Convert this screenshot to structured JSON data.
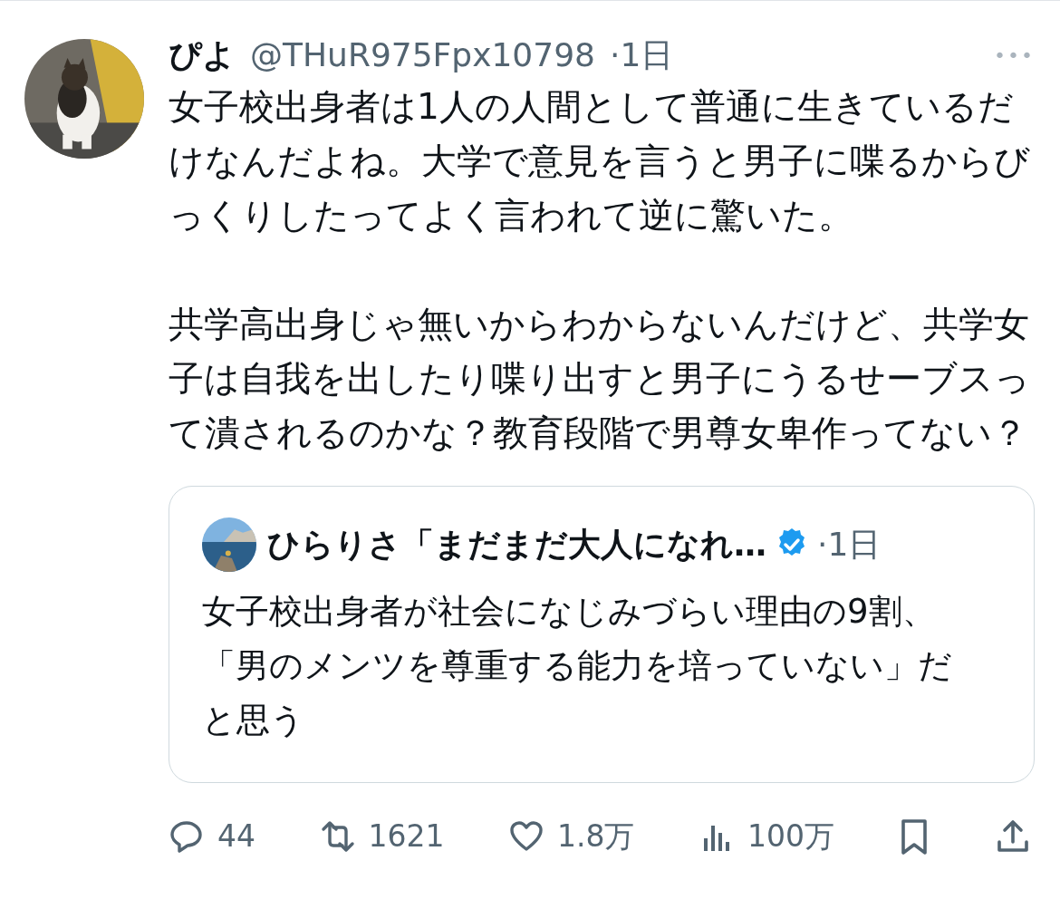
{
  "tweet": {
    "author": {
      "name": "ぴよ",
      "handle": "@THuR975Fpx10798",
      "time": "·1日"
    },
    "more": "•••",
    "paragraphs": [
      "女子校出身者は1人の人間として普通に生きているだけなんだよね。大学で意見を言うと男子に喋るからびっくりしたってよく言われて逆に驚いた。",
      "共学高出身じゃ無いからわからないんだけど、共学女子は自我を出したり喋り出すと男子にうるせーブスって潰されるのかな？教育段階で男尊女卑作ってない？"
    ],
    "quote": {
      "name": "ひらりさ「まだまだ大人になれ…",
      "verified": true,
      "time": "·1日",
      "text": "女子校出身者が社会になじみづらい理由の9割、「男のメンツを尊重する能力を培っていない」だと思う"
    },
    "actions": [
      {
        "kind": "reply",
        "count": "44"
      },
      {
        "kind": "retweet",
        "count": "1621"
      },
      {
        "kind": "like",
        "count": "1.8万"
      },
      {
        "kind": "views",
        "count": "100万"
      },
      {
        "kind": "bookmark"
      },
      {
        "kind": "share"
      }
    ]
  }
}
